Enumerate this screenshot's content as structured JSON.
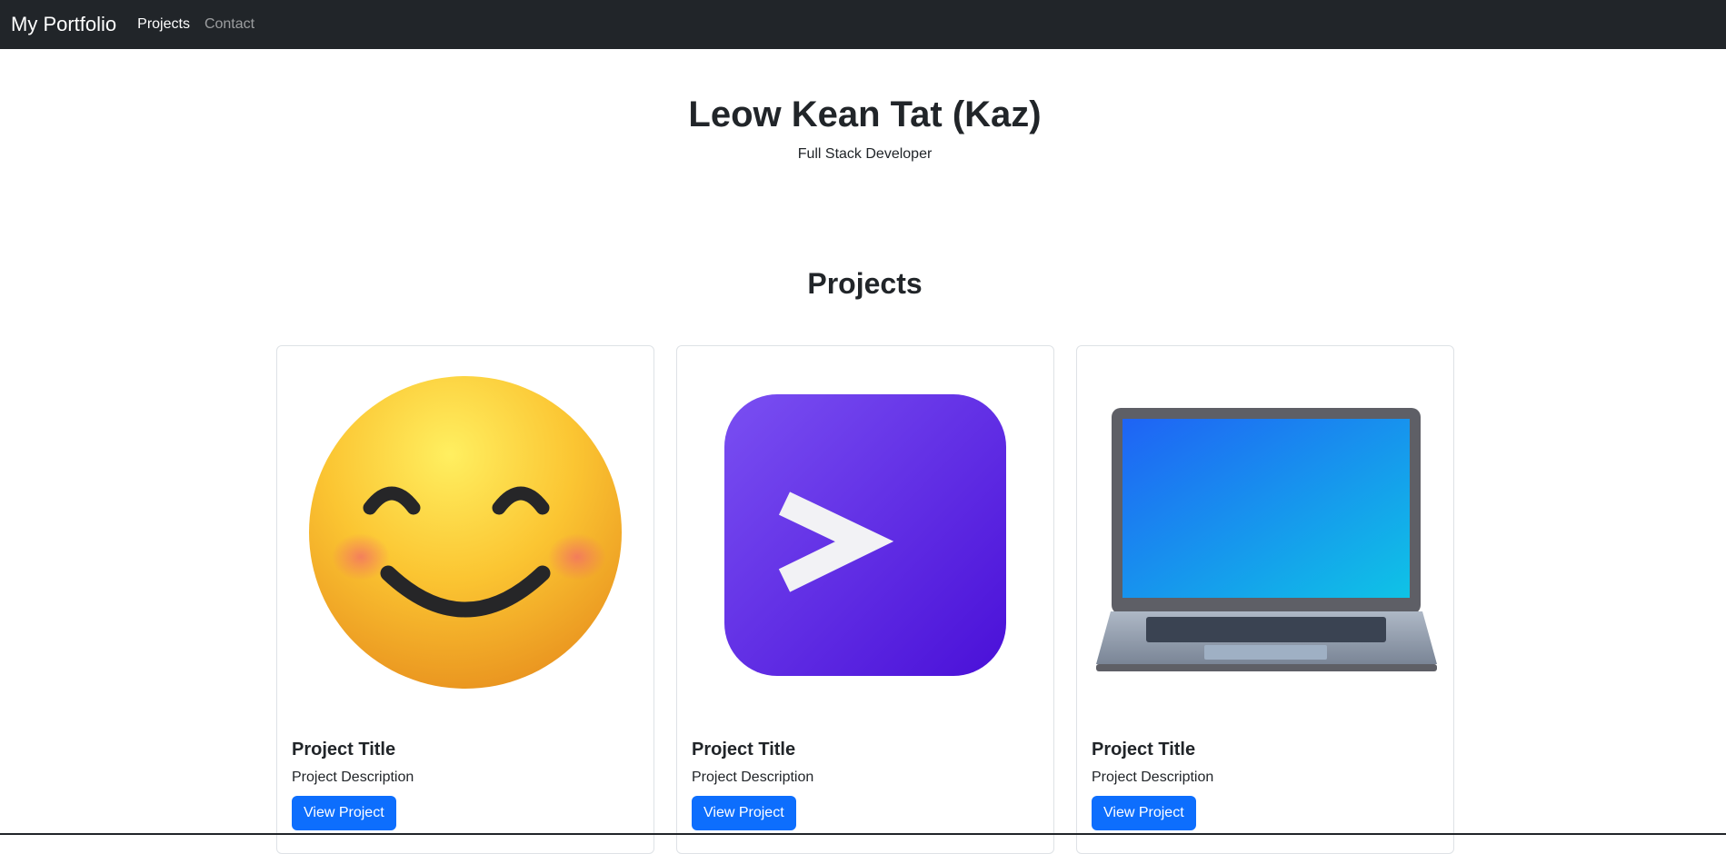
{
  "navbar": {
    "brand": "My Portfolio",
    "links": [
      {
        "label": "Projects",
        "active": true
      },
      {
        "label": "Contact",
        "active": false
      }
    ]
  },
  "hero": {
    "name": "Leow Kean Tat (Kaz)",
    "role": "Full Stack Developer"
  },
  "projects_section": {
    "heading": "Projects",
    "cards": [
      {
        "image_icon": "smiling-face-icon",
        "title": "Project Title",
        "description": "Project Description",
        "button": "View Project"
      },
      {
        "image_icon": "terminal-prompt-icon",
        "title": "Project Title",
        "description": "Project Description",
        "button": "View Project"
      },
      {
        "image_icon": "laptop-icon",
        "title": "Project Title",
        "description": "Project Description",
        "button": "View Project"
      }
    ]
  },
  "colors": {
    "navbar": "#212529",
    "primary_button": "#0d6efd",
    "text": "#212529",
    "card_border": "#dee2e6"
  }
}
